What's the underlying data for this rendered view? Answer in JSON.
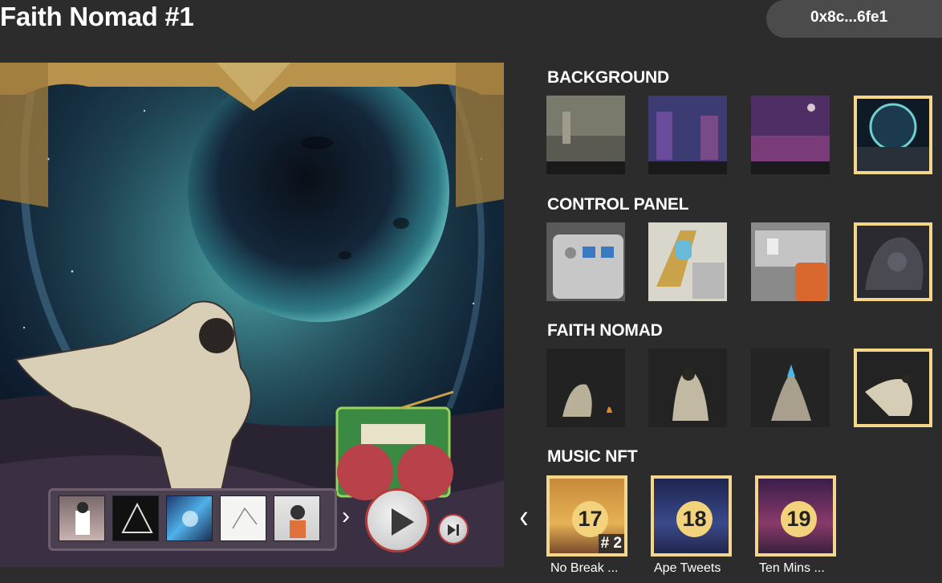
{
  "header": {
    "title": "Faith Nomad #1",
    "wallet_address": "0x8c...6fe1"
  },
  "artwork": {
    "player": {
      "thumbnails": [
        "track-thumb",
        "track-thumb",
        "track-thumb",
        "track-thumb",
        "track-thumb"
      ],
      "next_glyph": "›"
    }
  },
  "traits": {
    "background": {
      "label": "BACKGROUND",
      "selected_index": 3
    },
    "control_panel": {
      "label": "CONTROL PANEL",
      "selected_index": 3
    },
    "faith_nomad": {
      "label": "FAITH NOMAD",
      "selected_index": 3
    },
    "music_nft": {
      "label": "MUSIC NFT",
      "prev_glyph": "‹",
      "items": [
        {
          "number": "17",
          "title": "No Break ...",
          "edition": "# 2"
        },
        {
          "number": "18",
          "title": "Ape Tweets",
          "edition": ""
        },
        {
          "number": "19",
          "title": "Ten Mins ...",
          "edition": ""
        }
      ]
    }
  },
  "colors": {
    "background": "#2c2c2c",
    "wallet_pill": "#4b4b4b",
    "selection_border": "#f5d78c",
    "number_badge": "#f3d27c",
    "play_ring": "#b53b3b"
  }
}
